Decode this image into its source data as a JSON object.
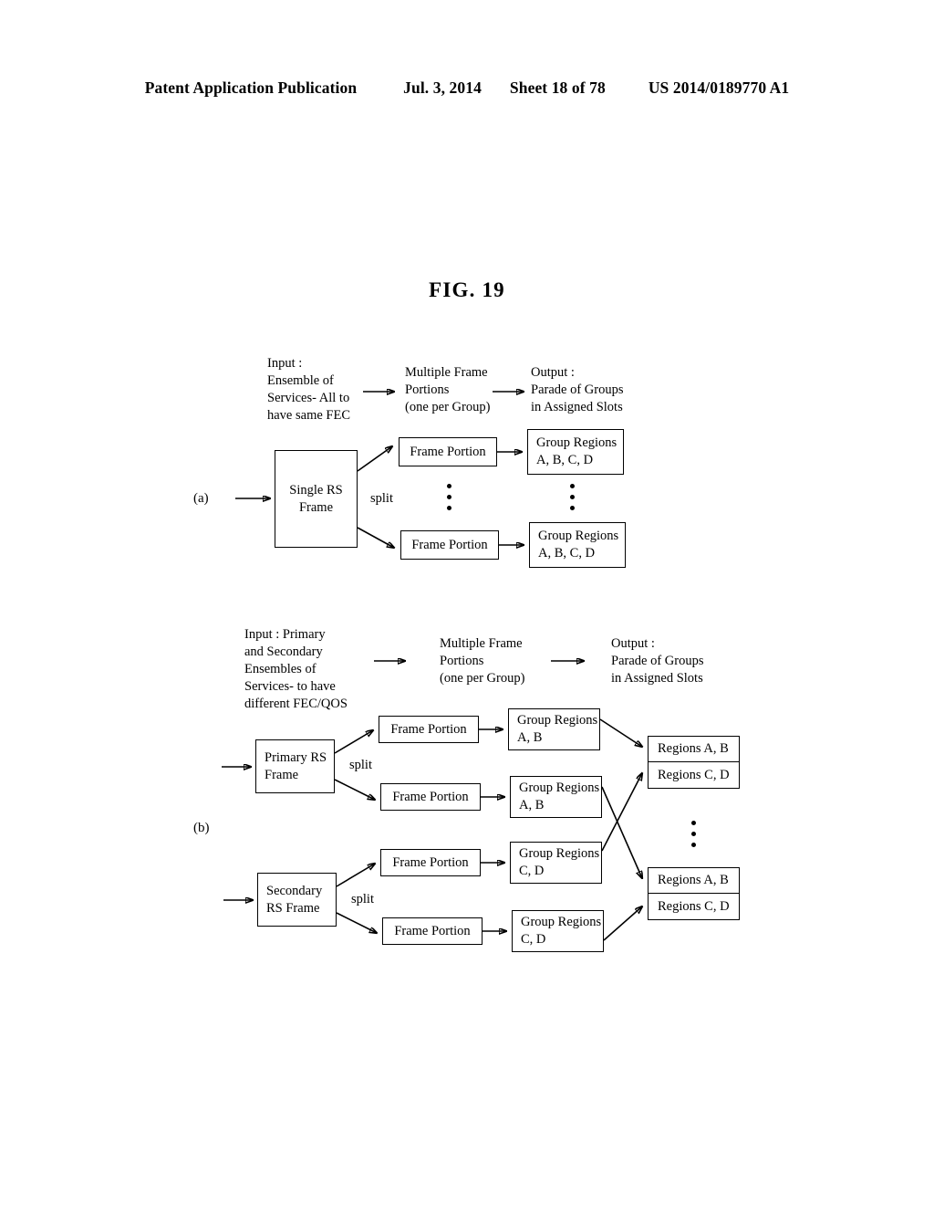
{
  "header": {
    "publication": "Patent Application Publication",
    "date": "Jul. 3, 2014",
    "sheet": "Sheet 18 of 78",
    "patent_number": "US 2014/0189770 A1"
  },
  "figure": {
    "title": "FIG. 19"
  },
  "diagram_a": {
    "part_label": "(a)",
    "split_label": "split",
    "headings": {
      "input": "Input :\nEnsemble of\nServices- All to\nhave same FEC",
      "middle": "Multiple Frame\nPortions\n(one per Group)",
      "output": "Output :\nParade of Groups\nin Assigned Slots"
    },
    "source_box": "Single RS\nFrame",
    "portions": [
      {
        "portion": "Frame Portion",
        "group": "Group Regions\nA, B, C, D"
      },
      {
        "portion": "Frame Portion",
        "group": "Group Regions\nA, B, C, D"
      }
    ]
  },
  "diagram_b": {
    "part_label": "(b)",
    "headings": {
      "input": "Input : Primary\nand Secondary\nEnsembles of\nServices- to have\ndifferent FEC/QOS",
      "middle": "Multiple Frame\nPortions\n(one per Group)",
      "output": "Output :\nParade of Groups\nin Assigned Slots"
    },
    "primary": {
      "source_box": "Primary RS\nFrame",
      "split_label": "split",
      "portions": [
        {
          "portion": "Frame Portion",
          "group": "Group Regions\nA, B"
        },
        {
          "portion": "Frame Portion",
          "group": "Group Regions\nA, B"
        }
      ]
    },
    "secondary": {
      "source_box": "Secondary\nRS Frame",
      "split_label": "split",
      "portions": [
        {
          "portion": "Frame Portion",
          "group": "Group Regions\nC, D"
        },
        {
          "portion": "Frame Portion",
          "group": "Group Regions\nC, D"
        }
      ]
    },
    "slots": [
      {
        "row_top": "Regions A, B",
        "row_bottom": "Regions C, D"
      },
      {
        "row_top": "Regions A, B",
        "row_bottom": "Regions C, D"
      }
    ]
  }
}
